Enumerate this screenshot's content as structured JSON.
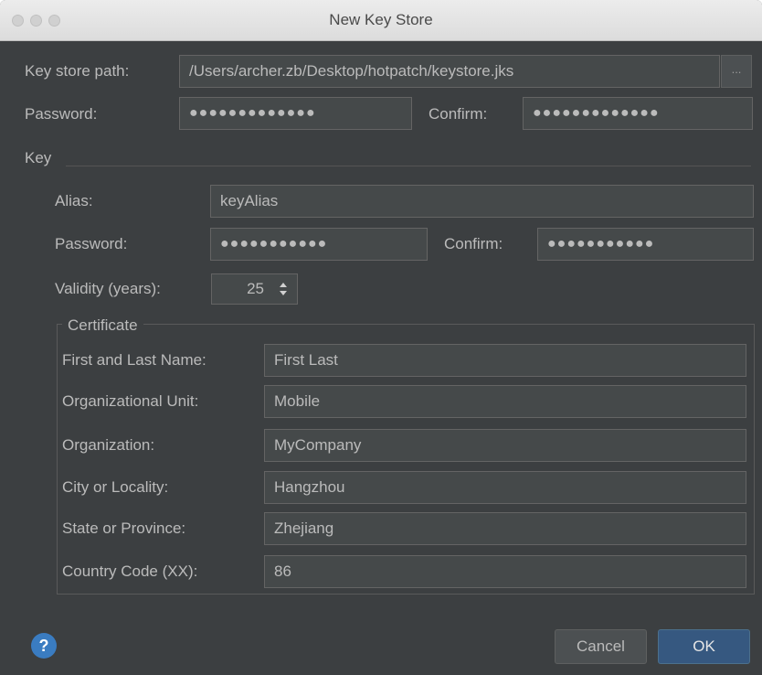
{
  "window": {
    "title": "New Key Store"
  },
  "keystore": {
    "path_label": "Key store path:",
    "path_value": "/Users/archer.zb/Desktop/hotpatch/keystore.jks",
    "browse_label": "...",
    "password_label": "Password:",
    "password_value": "●●●●●●●●●●●●●",
    "confirm_label": "Confirm:",
    "confirm_value": "●●●●●●●●●●●●●"
  },
  "key": {
    "section_label": "Key",
    "alias_label": "Alias:",
    "alias_value": "keyAlias",
    "password_label": "Password:",
    "password_value": "●●●●●●●●●●●",
    "confirm_label": "Confirm:",
    "confirm_value": "●●●●●●●●●●●",
    "validity_label": "Validity (years):",
    "validity_value": "25"
  },
  "certificate": {
    "legend": "Certificate",
    "fields": [
      {
        "label": "First and Last Name:",
        "value": "First Last"
      },
      {
        "label": "Organizational Unit:",
        "value": "Mobile"
      },
      {
        "label": "Organization:",
        "value": "MyCompany"
      },
      {
        "label": "City or Locality:",
        "value": "Hangzhou"
      },
      {
        "label": "State or Province:",
        "value": "Zhejiang"
      },
      {
        "label": "Country Code (XX):",
        "value": "86"
      }
    ]
  },
  "footer": {
    "help_label": "?",
    "cancel_label": "Cancel",
    "ok_label": "OK"
  },
  "colors": {
    "background": "#3c3f41",
    "field_bg": "#45494a",
    "ok_button": "#365880",
    "help_icon": "#3a7cc1"
  }
}
